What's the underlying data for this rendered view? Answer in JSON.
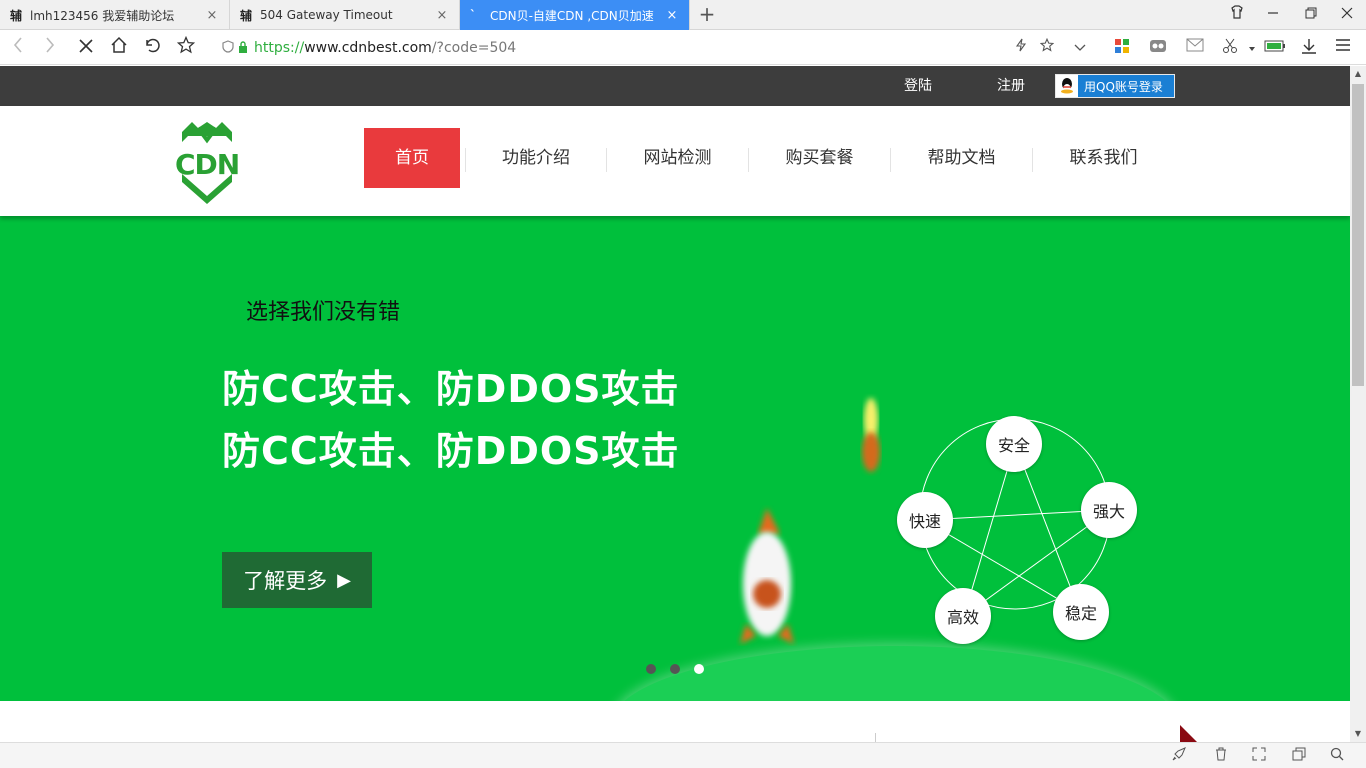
{
  "browser": {
    "tabs": [
      {
        "favicon": "辅",
        "title": "lmh123456 我爱辅助论坛",
        "close": "×"
      },
      {
        "favicon": "辅",
        "title": "504 Gateway Timeout",
        "close": "×"
      },
      {
        "favicon": "`",
        "title": "CDN贝-自建CDN ,CDN贝加速",
        "close": "×"
      }
    ],
    "new_tab": "+",
    "url": {
      "protocol": "https://",
      "host": "www.cdnbest.com",
      "path": "/?code=504"
    },
    "accent_color": "#3c8ef5"
  },
  "site": {
    "top_links": {
      "login": "登陆",
      "register": "注册",
      "qq_login": "用QQ账号登录"
    },
    "logo_text": "CDN",
    "brand_color": "#00c03c",
    "menu": [
      "首页",
      "功能介绍",
      "网站检测",
      "购买套餐",
      "帮助文档",
      "联系我们"
    ],
    "menu_active_color": "#e93a3d",
    "hero": {
      "subtitle": "选择我们没有错",
      "headline_1": "防CC攻击、防DDOS攻击",
      "headline_2": "防CC攻击、防DDOS攻击",
      "button": "了解更多",
      "button_arrow": "▶",
      "pentagon": [
        "安全",
        "强大",
        "稳定",
        "高效",
        "快速"
      ],
      "slides": 3,
      "active_slide": 3
    }
  }
}
